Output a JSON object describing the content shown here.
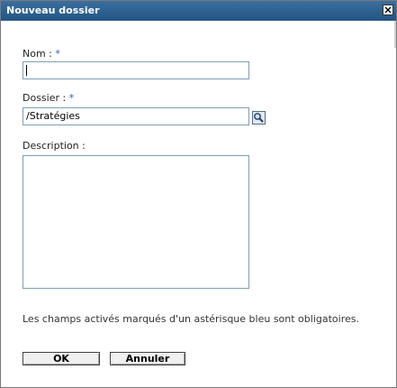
{
  "window": {
    "title": "Nouveau dossier"
  },
  "form": {
    "name_label": "Nom : ",
    "name_required": "*",
    "name_value": "",
    "folder_label": "Dossier : ",
    "folder_required": "*",
    "folder_value": "/Stratégies",
    "description_label": "Description :",
    "description_value": ""
  },
  "footer": {
    "note": "Les champs activés marqués d'un astérisque bleu sont obligatoires.",
    "ok_label": "OK",
    "cancel_label": "Annuler"
  },
  "icons": {
    "close": "close-icon",
    "lookup": "magnifier-icon"
  },
  "colors": {
    "titlebar": "#2b5f8f",
    "required_asterisk": "#2f5f9e",
    "field_border": "#7f9db9"
  }
}
